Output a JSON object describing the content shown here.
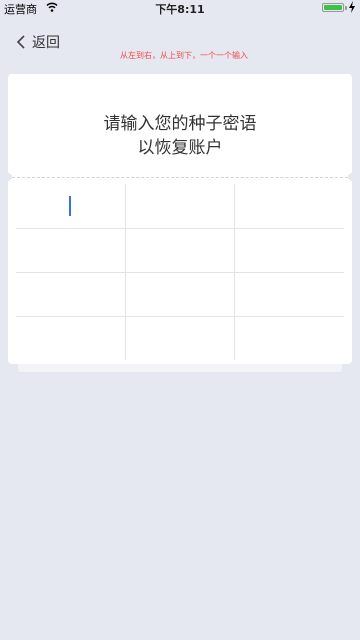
{
  "status_bar": {
    "carrier": "运营商",
    "time": "下午8:11",
    "wifi_icon": "wifi-icon",
    "battery_icon": "battery-icon",
    "charge_icon": "charging-bolt-icon",
    "battery_color": "#3cc249"
  },
  "nav": {
    "back_label": "返回",
    "back_icon": "chevron-left-icon"
  },
  "hint": "从左到右，从上到下，一个一个输入",
  "hint_color": "#f04848",
  "card": {
    "title_line1": "请输入您的种子密语",
    "title_line2": "以恢复账户"
  },
  "seed_words": [
    "",
    "",
    "",
    "",
    "",
    "",
    "",
    "",
    "",
    "",
    "",
    ""
  ],
  "colors": {
    "background": "#e6e8f1",
    "card": "#ffffff",
    "caret": "#3a6ee8"
  }
}
